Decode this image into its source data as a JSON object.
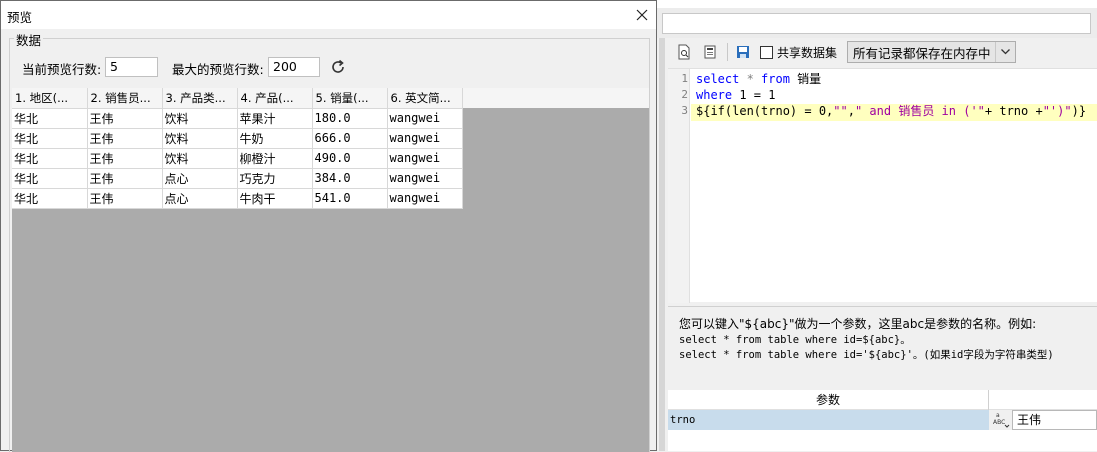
{
  "dialog": {
    "title": "预览",
    "group_label": "数据",
    "current_rows_label": "当前预览行数:",
    "current_rows_value": "5",
    "max_rows_label": "最大的预览行数:",
    "max_rows_value": "200",
    "columns": [
      "1. 地区(...",
      "2. 销售员...",
      "3. 产品类...",
      "4. 产品(...",
      "5. 销量(...",
      "6. 英文简..."
    ],
    "rows": [
      [
        "华北",
        "王伟",
        "饮料",
        "苹果汁",
        "180.0",
        "wangwei"
      ],
      [
        "华北",
        "王伟",
        "饮料",
        "牛奶",
        "666.0",
        "wangwei"
      ],
      [
        "华北",
        "王伟",
        "饮料",
        "柳橙汁",
        "490.0",
        "wangwei"
      ],
      [
        "华北",
        "王伟",
        "点心",
        "巧克力",
        "384.0",
        "wangwei"
      ],
      [
        "华北",
        "王伟",
        "点心",
        "牛肉干",
        "541.0",
        "wangwei"
      ]
    ]
  },
  "editor": {
    "toolbar": {
      "share_checkbox_label": "共享数据集",
      "storage_select_value": "所有记录都保存在内存中"
    },
    "line_numbers": [
      "1",
      "2",
      "3"
    ],
    "sql": {
      "l1_select": "select",
      "l1_star": " * ",
      "l1_from": "from",
      "l1_table": " 销量",
      "l2_where": "where",
      "l2_rest": " 1 = 1",
      "l3_a": "${if(len(trno) = 0,",
      "l3_s1": "\"\"",
      "l3_b": ",",
      "l3_s2": "\" and 销售员 in ('\"",
      "l3_c": "+ trno +",
      "l3_s3": "\"')\"",
      "l3_d": ")}"
    },
    "hint": {
      "line1": "您可以键入\"${abc}\"做为一个参数，这里abc是参数的名称。例如:",
      "line2": "select * from table where id=${abc}。",
      "line3": "select * from table where id='${abc}'。(如果id字段为字符串类型)"
    },
    "params": {
      "header": "参数",
      "rows": [
        {
          "name": "trno",
          "type_icon": "abc-icon",
          "value": "王伟"
        }
      ]
    }
  }
}
